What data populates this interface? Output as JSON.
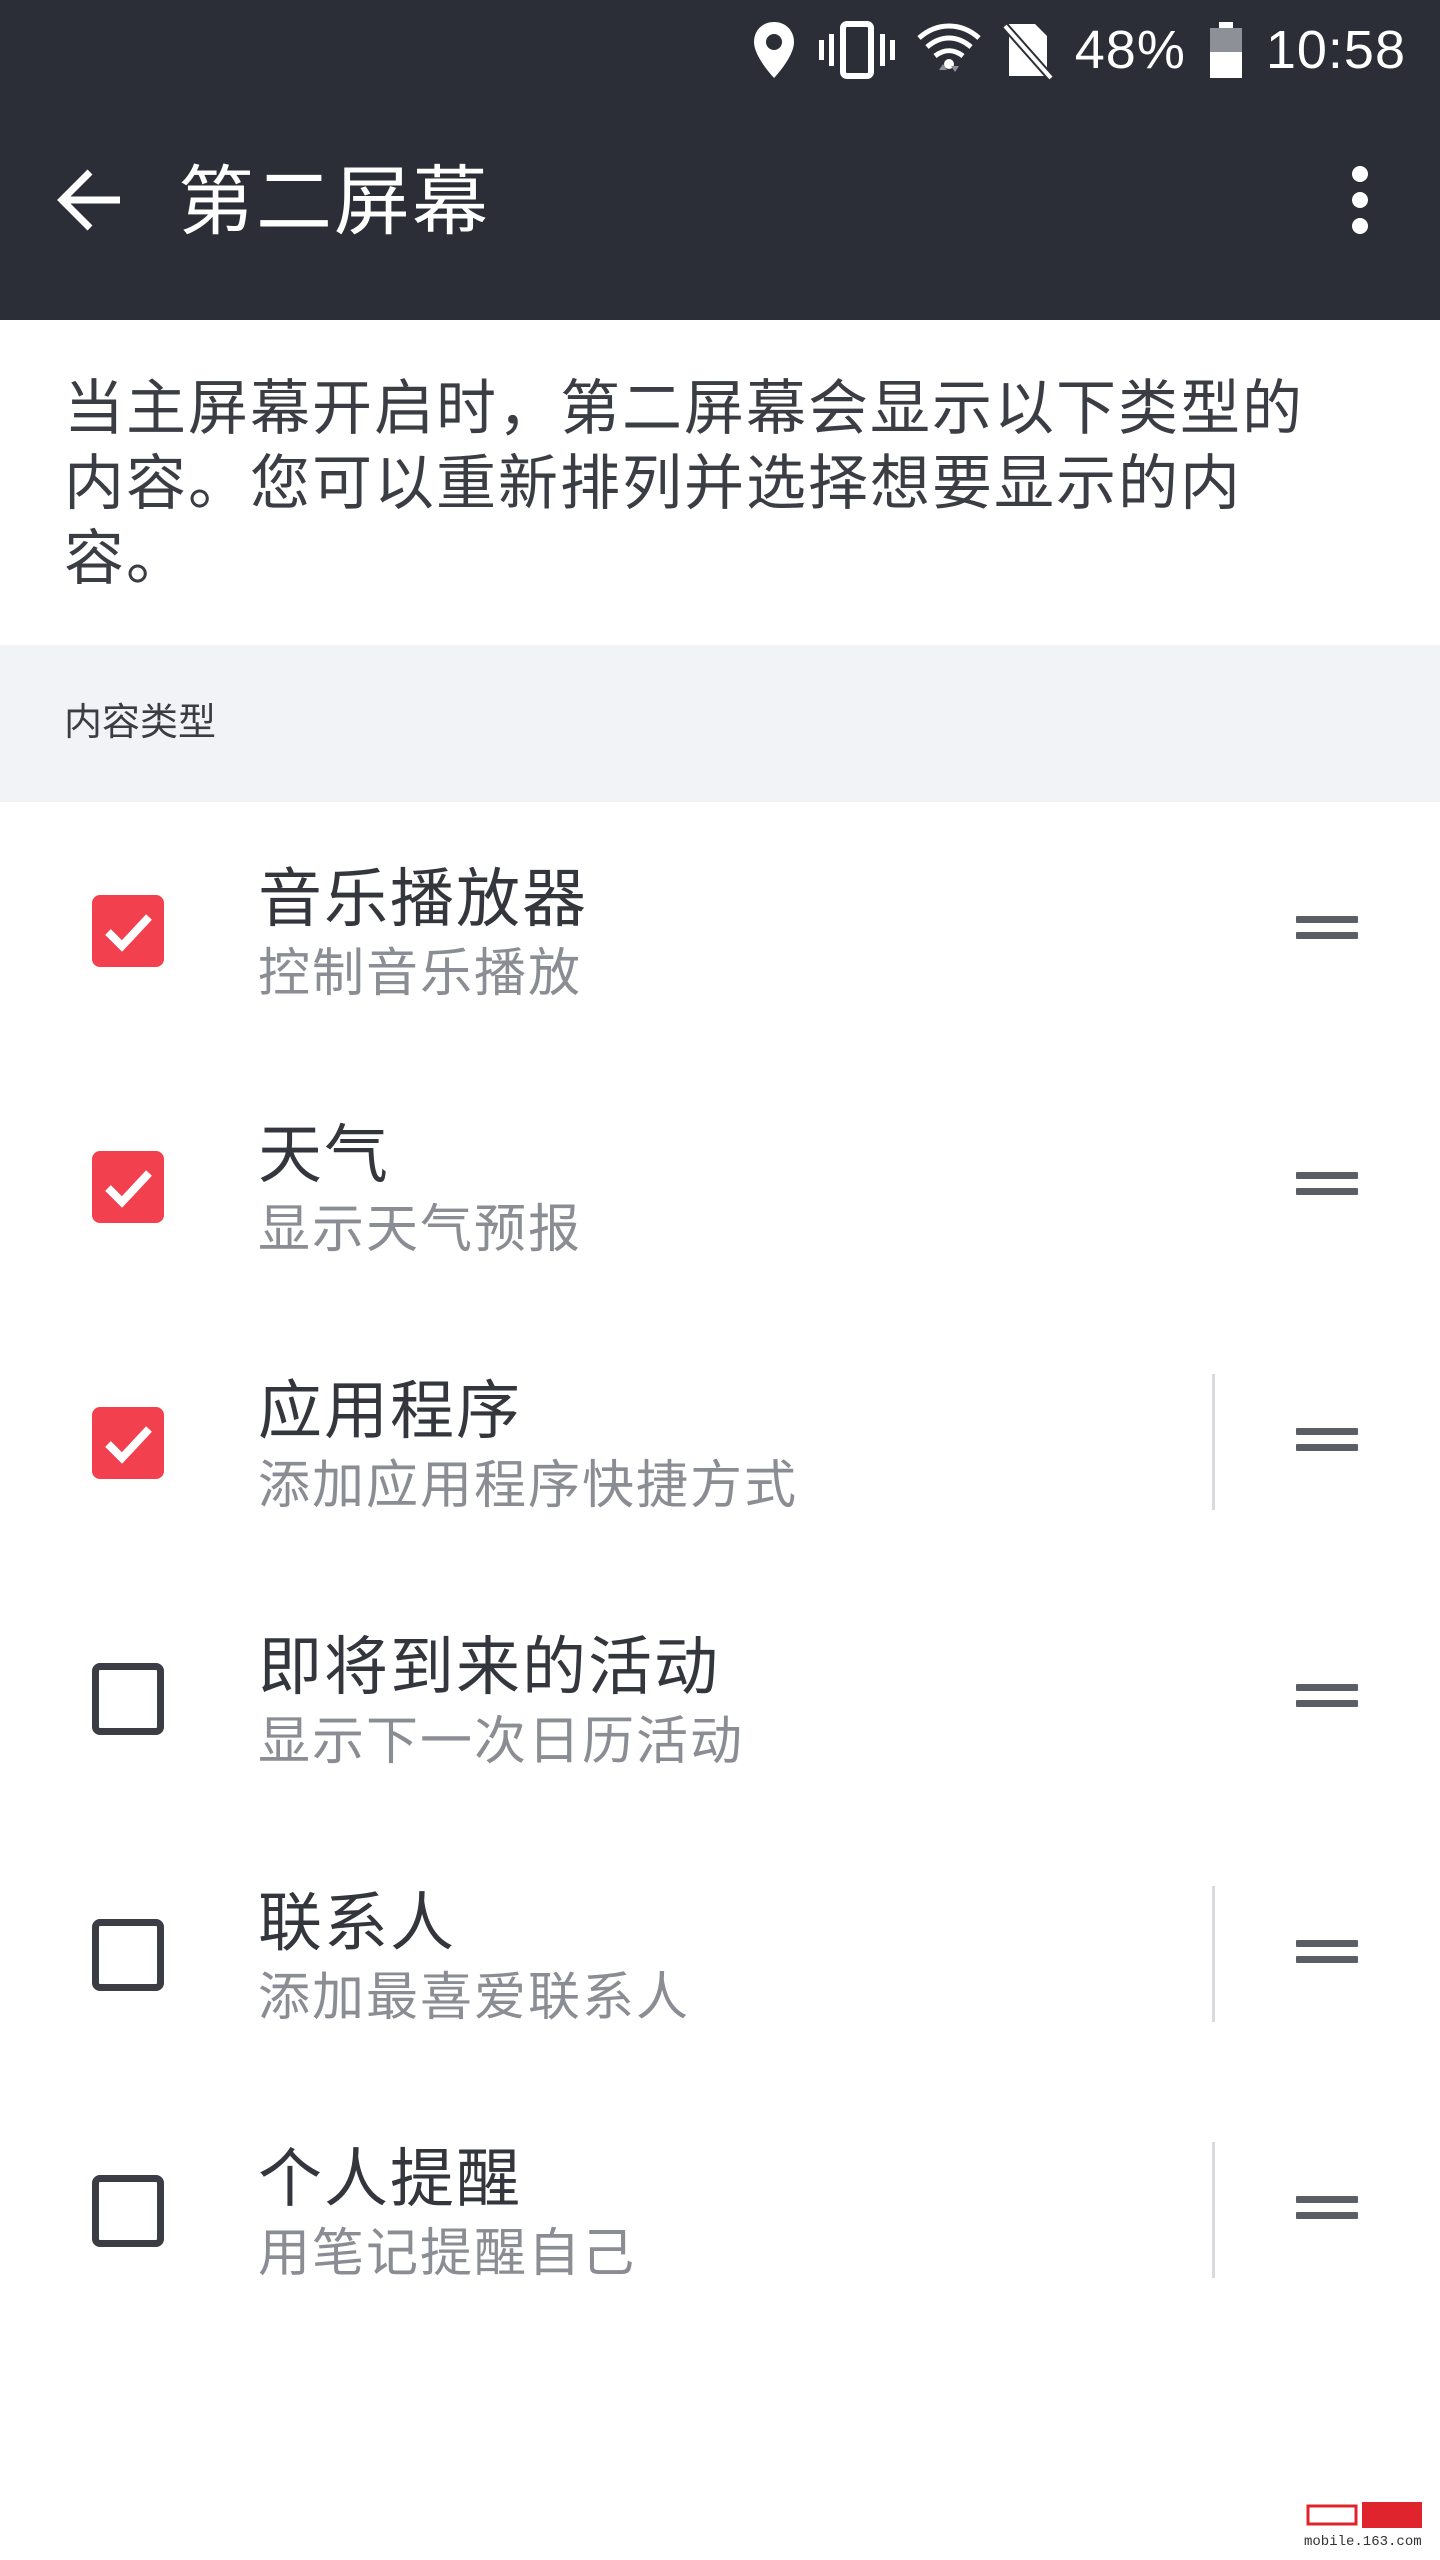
{
  "status_bar": {
    "battery_percent": "48%",
    "time": "10:58",
    "icons": [
      "location-icon",
      "vibrate-icon",
      "wifi-icon",
      "no-sim-icon",
      "battery-icon"
    ]
  },
  "app_bar": {
    "title": "第二屏幕"
  },
  "description": "当主屏幕开启时，第二屏幕会显示以下类型的内容。您可以重新排列并选择想要显示的内容。",
  "section": {
    "label": "内容类型"
  },
  "items": [
    {
      "title": "音乐播放器",
      "subtitle": "控制音乐播放",
      "checked": true,
      "divider": false
    },
    {
      "title": "天气",
      "subtitle": "显示天气预报",
      "checked": true,
      "divider": false
    },
    {
      "title": "应用程序",
      "subtitle": "添加应用程序快捷方式",
      "checked": true,
      "divider": true
    },
    {
      "title": "即将到来的活动",
      "subtitle": "显示下一次日历活动",
      "checked": false,
      "divider": false
    },
    {
      "title": "联系人",
      "subtitle": "添加最喜爱联系人",
      "checked": false,
      "divider": true
    },
    {
      "title": "个人提醒",
      "subtitle": "用笔记提醒自己",
      "checked": false,
      "divider": true
    }
  ],
  "colors": {
    "app_bar_bg": "#2b2e36",
    "accent": "#f2404f",
    "section_bg": "#f1f3f6"
  },
  "watermark": "mobile.163.com"
}
